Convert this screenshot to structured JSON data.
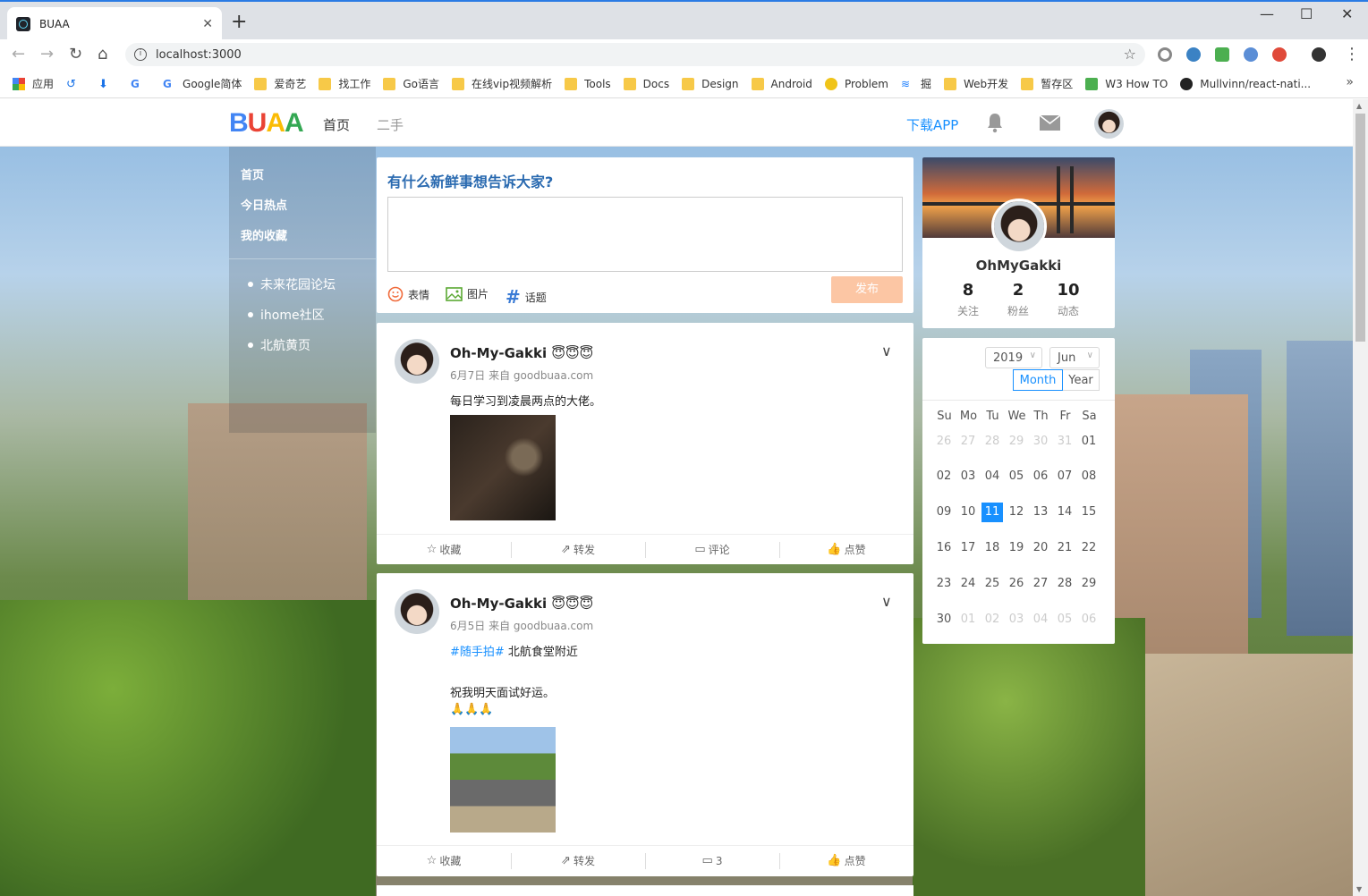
{
  "browser": {
    "tab_title": "BUAA",
    "url": "localhost:3000",
    "bookmarks": [
      {
        "label": "应用",
        "icon": "apps-icon"
      },
      {
        "label": "",
        "icon": "history-icon"
      },
      {
        "label": "",
        "icon": "download-icon"
      },
      {
        "label": "",
        "icon": "google-icon"
      },
      {
        "label": "Google简体",
        "icon": "google-icon"
      },
      {
        "label": "爱奇艺",
        "icon": "folder-icon"
      },
      {
        "label": "找工作",
        "icon": "folder-icon"
      },
      {
        "label": "Go语言",
        "icon": "folder-icon"
      },
      {
        "label": "在线vip视频解析",
        "icon": "folder-icon"
      },
      {
        "label": "Tools",
        "icon": "folder-icon"
      },
      {
        "label": "Docs",
        "icon": "folder-icon"
      },
      {
        "label": "Design",
        "icon": "folder-icon"
      },
      {
        "label": "Android",
        "icon": "folder-icon"
      },
      {
        "label": "Problem",
        "icon": "problem-icon"
      },
      {
        "label": "掘",
        "icon": "juejin-icon"
      },
      {
        "label": "Web开发",
        "icon": "folder-icon"
      },
      {
        "label": "暂存区",
        "icon": "folder-icon"
      },
      {
        "label": "W3 How TO",
        "icon": "w3-icon"
      },
      {
        "label": "Mullvinn/react-nati...",
        "icon": "github-icon"
      }
    ],
    "bookmarks_more": "»"
  },
  "header": {
    "logo": {
      "b": "B",
      "u": "U",
      "a1": "A",
      "a2": "A"
    },
    "nav_home": "首页",
    "nav_second": "二手",
    "download_app": "下载APP"
  },
  "sidebar": {
    "links": [
      "首页",
      "今日热点",
      "我的收藏"
    ],
    "external": [
      "未来花园论坛",
      "ihome社区",
      "北航黄页"
    ]
  },
  "composer": {
    "title": "有什么新鲜事想告诉大家?",
    "tools": [
      "表情",
      "图片",
      "话题"
    ],
    "publish": "发布"
  },
  "posts": [
    {
      "author": "Oh-My-Gakki 😇😇😇",
      "meta": "6月7日 来自 goodbuaa.com",
      "text": "每日学习到凌晨两点的大佬。",
      "actions": [
        "收藏",
        "转发",
        "评论",
        "点赞"
      ]
    },
    {
      "author": "Oh-My-Gakki 😇😇😇",
      "meta": "6月5日 来自 goodbuaa.com",
      "hashtag": "#随手拍#",
      "text1": " 北航食堂附近",
      "text2": "祝我明天面试好运。",
      "text3": "🙏🙏🙏",
      "actions": [
        "收藏",
        "转发",
        "3",
        "点赞"
      ]
    }
  ],
  "profile": {
    "name": "OhMyGakki",
    "stats": [
      {
        "n": "8",
        "l": "关注"
      },
      {
        "n": "2",
        "l": "粉丝"
      },
      {
        "n": "10",
        "l": "动态"
      }
    ]
  },
  "calendar": {
    "year": "2019",
    "month": "Jun",
    "mode_month": "Month",
    "mode_year": "Year",
    "weekdays": [
      "Su",
      "Mo",
      "Tu",
      "We",
      "Th",
      "Fr",
      "Sa"
    ],
    "weeks": [
      [
        "26",
        "27",
        "28",
        "29",
        "30",
        "31",
        "01"
      ],
      [
        "02",
        "03",
        "04",
        "05",
        "06",
        "07",
        "08"
      ],
      [
        "09",
        "10",
        "11",
        "12",
        "13",
        "14",
        "15"
      ],
      [
        "16",
        "17",
        "18",
        "19",
        "20",
        "21",
        "22"
      ],
      [
        "23",
        "24",
        "25",
        "26",
        "27",
        "28",
        "29"
      ],
      [
        "30",
        "01",
        "02",
        "03",
        "04",
        "05",
        "06"
      ]
    ],
    "today": "11",
    "accent": "#1890ff"
  }
}
